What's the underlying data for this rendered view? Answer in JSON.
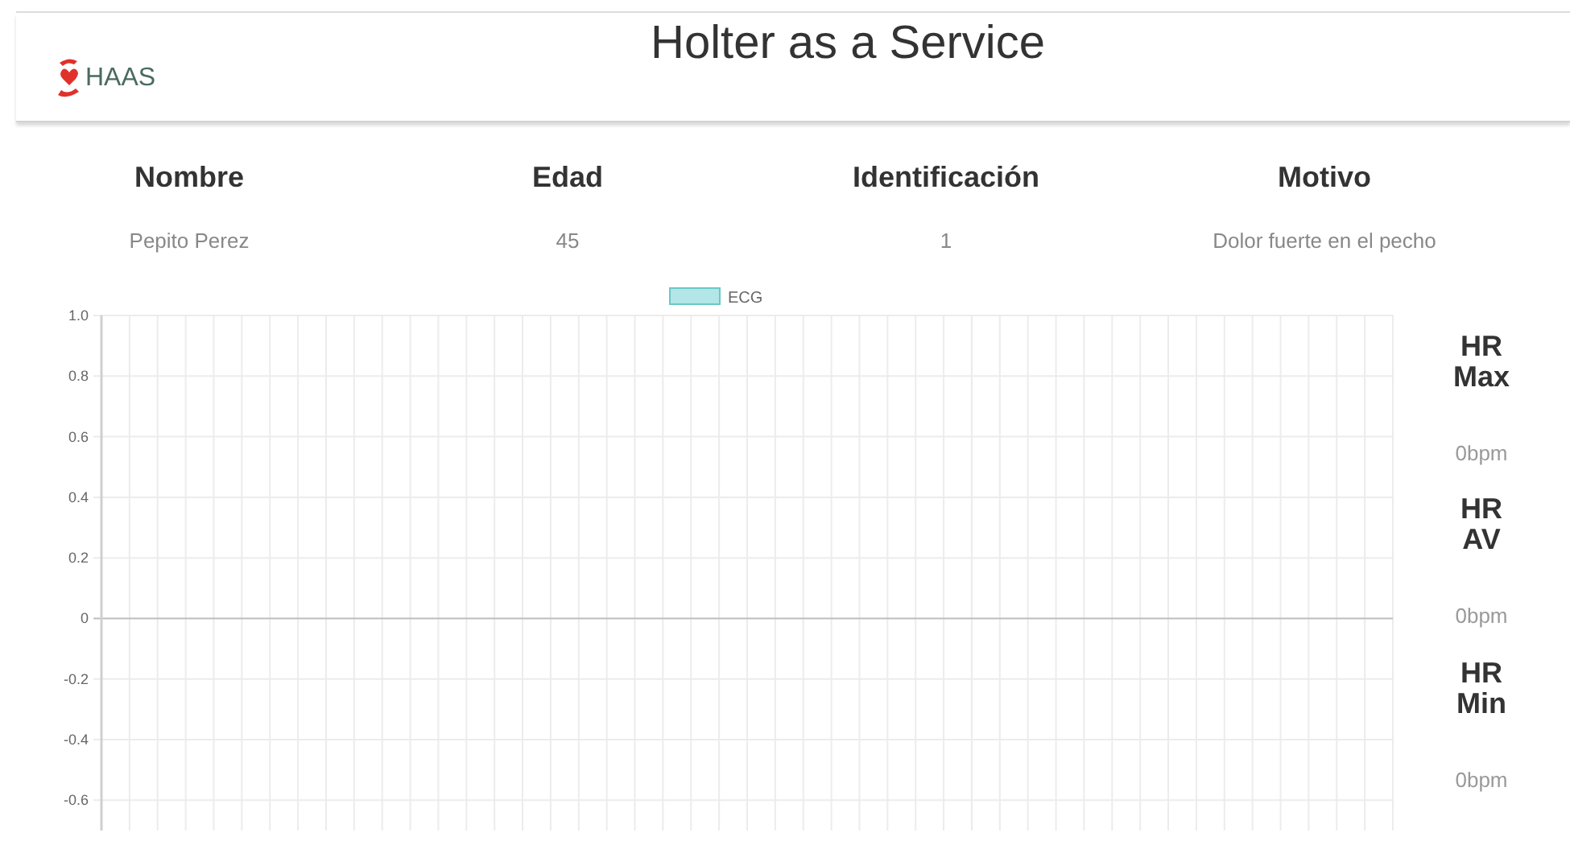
{
  "header": {
    "logo_text": "HAAS",
    "title": "Holter as a Service"
  },
  "patient_table": {
    "columns": [
      "Nombre",
      "Edad",
      "Identificación",
      "Motivo"
    ],
    "row": [
      "Pepito Perez",
      "45",
      "1",
      "Dolor fuerte en el pecho"
    ]
  },
  "ecg_chart": {
    "chart_data": {
      "type": "line",
      "grid": true,
      "series": [
        {
          "name": "ECG",
          "color": "#b3e6e6"
        }
      ],
      "ylim": [
        -0.7,
        1.0
      ],
      "yticks": [
        {
          "value": 1,
          "label": "1.0"
        },
        {
          "value": 0.8,
          "label": "0.8"
        },
        {
          "value": 0.6,
          "label": "0.6"
        },
        {
          "value": 0.4,
          "label": "0.4"
        },
        {
          "value": 0.2,
          "label": "0.2"
        },
        {
          "value": 0,
          "label": "0"
        },
        {
          "value": -0.2,
          "label": "-0.2"
        },
        {
          "value": -0.4,
          "label": "-0.4"
        },
        {
          "value": -0.6,
          "label": "-0.6"
        }
      ]
    }
  },
  "heart_rate": [
    {
      "label": "HR Max",
      "value": "0bpm"
    },
    {
      "label": "HR AV",
      "value": "0bpm"
    },
    {
      "label": "HR Min",
      "value": "0bpm"
    }
  ]
}
